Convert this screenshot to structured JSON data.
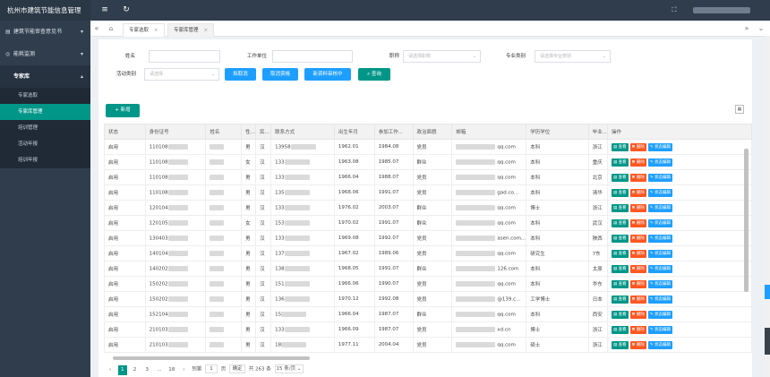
{
  "app": {
    "title": "杭州市建筑节能信息管理"
  },
  "sidebar": {
    "items": [
      {
        "label": "建筑节能审查意见书",
        "icon": "file-icon"
      },
      {
        "label": "能耗监测",
        "icon": "monitor-icon"
      },
      {
        "label": "专家库",
        "icon": ""
      }
    ],
    "sub": [
      "专家选取",
      "专家库管理",
      "培训管理",
      "活动年报",
      "培训年报"
    ]
  },
  "tabs": [
    {
      "label": "专家选取"
    },
    {
      "label": "专家库管理"
    }
  ],
  "filters": {
    "name_label": "姓名",
    "work_label": "工作单位",
    "title_label": "职称",
    "title_ph": "请选择职称",
    "major_label": "专业类别",
    "major_ph": "请选择专业类别",
    "activity_label": "活动类别",
    "activity_ph": "请选择"
  },
  "buttons": {
    "cancel": "拟取消",
    "cancel_qual": "取消资格",
    "new_review": "新资料审核中",
    "query": "查询",
    "add": "新增"
  },
  "table": {
    "headers": [
      "状态",
      "身份证号",
      "姓名",
      "性...",
      "民...",
      "联系方式",
      "出生年月",
      "参加工作...",
      "政治面貌",
      "邮箱",
      "学历学位",
      "毕业...",
      "操作"
    ],
    "ops": [
      "查看",
      "删除",
      "状态编辑"
    ],
    "rows": [
      [
        "启用",
        "110108",
        "",
        "男",
        "汉",
        "13958",
        "1962.01",
        "1984.08",
        "党员",
        "qq.com",
        "本科",
        "浙江"
      ],
      [
        "启用",
        "110108",
        "",
        "女",
        "汉",
        "133",
        "1963.08",
        "1985.07",
        "群众",
        "qq.com",
        "本科",
        "重庆"
      ],
      [
        "启用",
        "110108",
        "",
        "男",
        "汉",
        "133",
        "1966.04",
        "1988.07",
        "党员",
        "qq.com",
        "本科",
        "北京"
      ],
      [
        "启用",
        "110108",
        "",
        "男",
        "汉",
        "135",
        "1968.06",
        "1991.07",
        "党员",
        "gad.co...",
        "本科",
        "清华"
      ],
      [
        "启用",
        "120104",
        "",
        "男",
        "汉",
        "133",
        "1976.02",
        "2003.07",
        "群众",
        "qq.com",
        "博士",
        "浙江"
      ],
      [
        "启用",
        "120105",
        "",
        "女",
        "汉",
        "153",
        "1970.02",
        "1991.07",
        "群众",
        "qq.com",
        "本科",
        "武汉"
      ],
      [
        "启用",
        "130403",
        "",
        "男",
        "汉",
        "133",
        "1969.08",
        "1992.07",
        "党员",
        "asen.com...",
        "本科",
        "陕西"
      ],
      [
        "启用",
        "140104",
        "",
        "男",
        "汉",
        "137",
        "1967.02",
        "1989.06",
        "党员",
        "qq.com",
        "研究生",
        "7东"
      ],
      [
        "启用",
        "140202",
        "",
        "男",
        "汉",
        "138",
        "1968.05",
        "1991.07",
        "群众",
        "126.com",
        "本科",
        "太原"
      ],
      [
        "启用",
        "150202",
        "",
        "男",
        "汉",
        "151",
        "1966.06",
        "1990.07",
        "党员",
        "qq.com",
        "本科",
        "华东"
      ],
      [
        "启用",
        "150202",
        "",
        "男",
        "汉",
        "136",
        "1970.12",
        "1992.08",
        "党员",
        "@139.c...",
        "工学博士",
        "日本"
      ],
      [
        "启用",
        "152104",
        "",
        "男",
        "汉",
        "15",
        "1966.04",
        "1987.07",
        "群众",
        "qq.com",
        "本科",
        "西安"
      ],
      [
        "启用",
        "210103",
        "",
        "男",
        "汉",
        "133",
        "1966.09",
        "1987.07",
        "党员",
        "xd.cn",
        "博士",
        "浙江"
      ],
      [
        "启用",
        "210103",
        "",
        "男",
        "汉",
        "18",
        "1977.11",
        "2004.04",
        "党员",
        "qq.com",
        "硕士",
        "浙江"
      ]
    ]
  },
  "pager": {
    "pages": [
      "1",
      "2",
      "3",
      "...",
      "18"
    ],
    "goto": "到第",
    "page_val": "1",
    "page_unit": "页",
    "confirm": "确定",
    "total": "共 263 条",
    "per": "15 条/页"
  }
}
